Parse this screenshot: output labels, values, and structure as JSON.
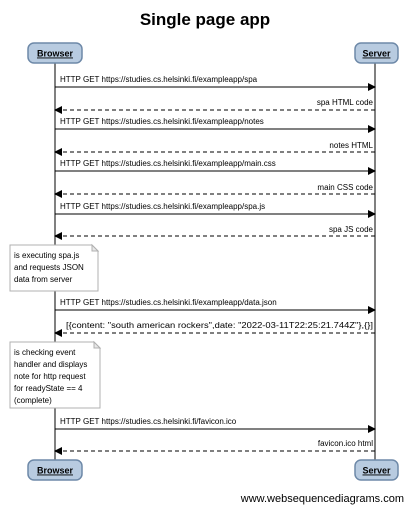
{
  "title": "Single page app",
  "participants": {
    "browser": "Browser",
    "server": "Server"
  },
  "messages": [
    {
      "label": "HTTP GET https://studies.cs.helsinki.fi/exampleapp/spa",
      "direction": "to-server",
      "style": "solid"
    },
    {
      "label": "spa HTML code",
      "direction": "to-browser",
      "style": "dashed"
    },
    {
      "label": "HTTP GET https://studies.cs.helsinki.fi/exampleapp/notes",
      "direction": "to-server",
      "style": "solid"
    },
    {
      "label": "notes HTML",
      "direction": "to-browser",
      "style": "dashed"
    },
    {
      "label": "HTTP GET https://studies.cs.helsinki.fi/exampleapp/main.css",
      "direction": "to-server",
      "style": "solid"
    },
    {
      "label": "main CSS code",
      "direction": "to-browser",
      "style": "dashed"
    },
    {
      "label": "HTTP GET https://studies.cs.helsinki.fi/exampleapp/spa.js",
      "direction": "to-server",
      "style": "solid"
    },
    {
      "label": "spa JS code",
      "direction": "to-browser",
      "style": "dashed"
    },
    {
      "label": "HTTP GET https://studies.cs.helsinki.fi/exampleapp/data.json",
      "direction": "to-server",
      "style": "solid"
    },
    {
      "label": "[{content: \"south american rockers\",date: \"2022-03-11T22:25:21.744Z\"},{}]",
      "direction": "to-browser",
      "style": "dashed"
    },
    {
      "label": "HTTP GET https://studies.cs.helsinki.fi/favicon.ico",
      "direction": "to-server",
      "style": "solid"
    },
    {
      "label": "favicon.ico html",
      "direction": "to-browser",
      "style": "dashed"
    }
  ],
  "notes": [
    {
      "lines": [
        "is executing spa.js",
        "and requests JSON",
        "data from server"
      ]
    },
    {
      "lines": [
        "is checking event",
        "handler and displays",
        "note for http request",
        "for readyState == 4",
        "(complete)"
      ]
    }
  ],
  "watermark": "www.websequencediagrams.com"
}
